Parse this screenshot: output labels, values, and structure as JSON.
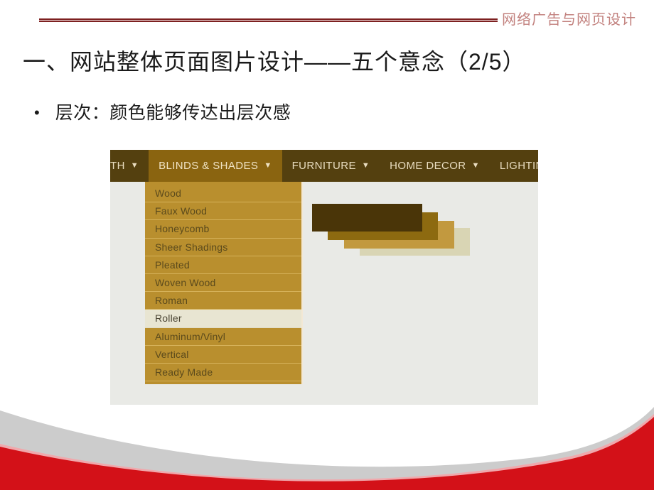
{
  "header": {
    "course_label": "网络广告与网页设计",
    "rule_color": "#7d2020",
    "label_color": "#c2817e"
  },
  "slide": {
    "title": "一、网站整体页面图片设计——五个意念（2/5）",
    "bullet_marker": "•",
    "bullet_text": "层次：颜色能够传达出层次感",
    "page_indicator": "2/5"
  },
  "screenshot": {
    "nav": {
      "items": [
        {
          "label": "TH",
          "caret": "▼",
          "active": false,
          "truncated_left": true
        },
        {
          "label": "BLINDS & SHADES",
          "caret": "▼",
          "active": true,
          "truncated_left": false
        },
        {
          "label": "FURNITURE",
          "caret": "▼",
          "active": false,
          "truncated_left": false
        },
        {
          "label": "HOME DECOR",
          "caret": "▼",
          "active": false,
          "truncated_left": false
        },
        {
          "label": "LIGHTIN",
          "caret": "",
          "active": false,
          "truncated_left": false
        }
      ],
      "bar_color": "#54400f",
      "active_color": "#8a6410",
      "text_color": "#e9ddc0"
    },
    "dropdown": {
      "items": [
        {
          "label": "Wood",
          "selected": false
        },
        {
          "label": "Faux Wood",
          "selected": false
        },
        {
          "label": "Honeycomb",
          "selected": false
        },
        {
          "label": "Sheer Shadings",
          "selected": false
        },
        {
          "label": "Pleated",
          "selected": false
        },
        {
          "label": "Woven Wood",
          "selected": false
        },
        {
          "label": "Roman",
          "selected": false
        },
        {
          "label": "Roller",
          "selected": true
        },
        {
          "label": "Aluminum/Vinyl",
          "selected": false
        },
        {
          "label": "Vertical",
          "selected": false
        },
        {
          "label": "Ready Made",
          "selected": false
        }
      ],
      "bg_color": "#b98f2e",
      "selected_bg_color": "#e8e5d2",
      "text_color": "#5b4a1c"
    },
    "cursor": {
      "type": "pointing-hand"
    },
    "page_bg_color": "#e9eae6",
    "cascade_colors": [
      "#4a3508",
      "#8d6a10",
      "#c2993f",
      "#d9d5b4"
    ]
  },
  "decoration": {
    "red_color": "#d31118",
    "gray_color": "#cccccc"
  }
}
